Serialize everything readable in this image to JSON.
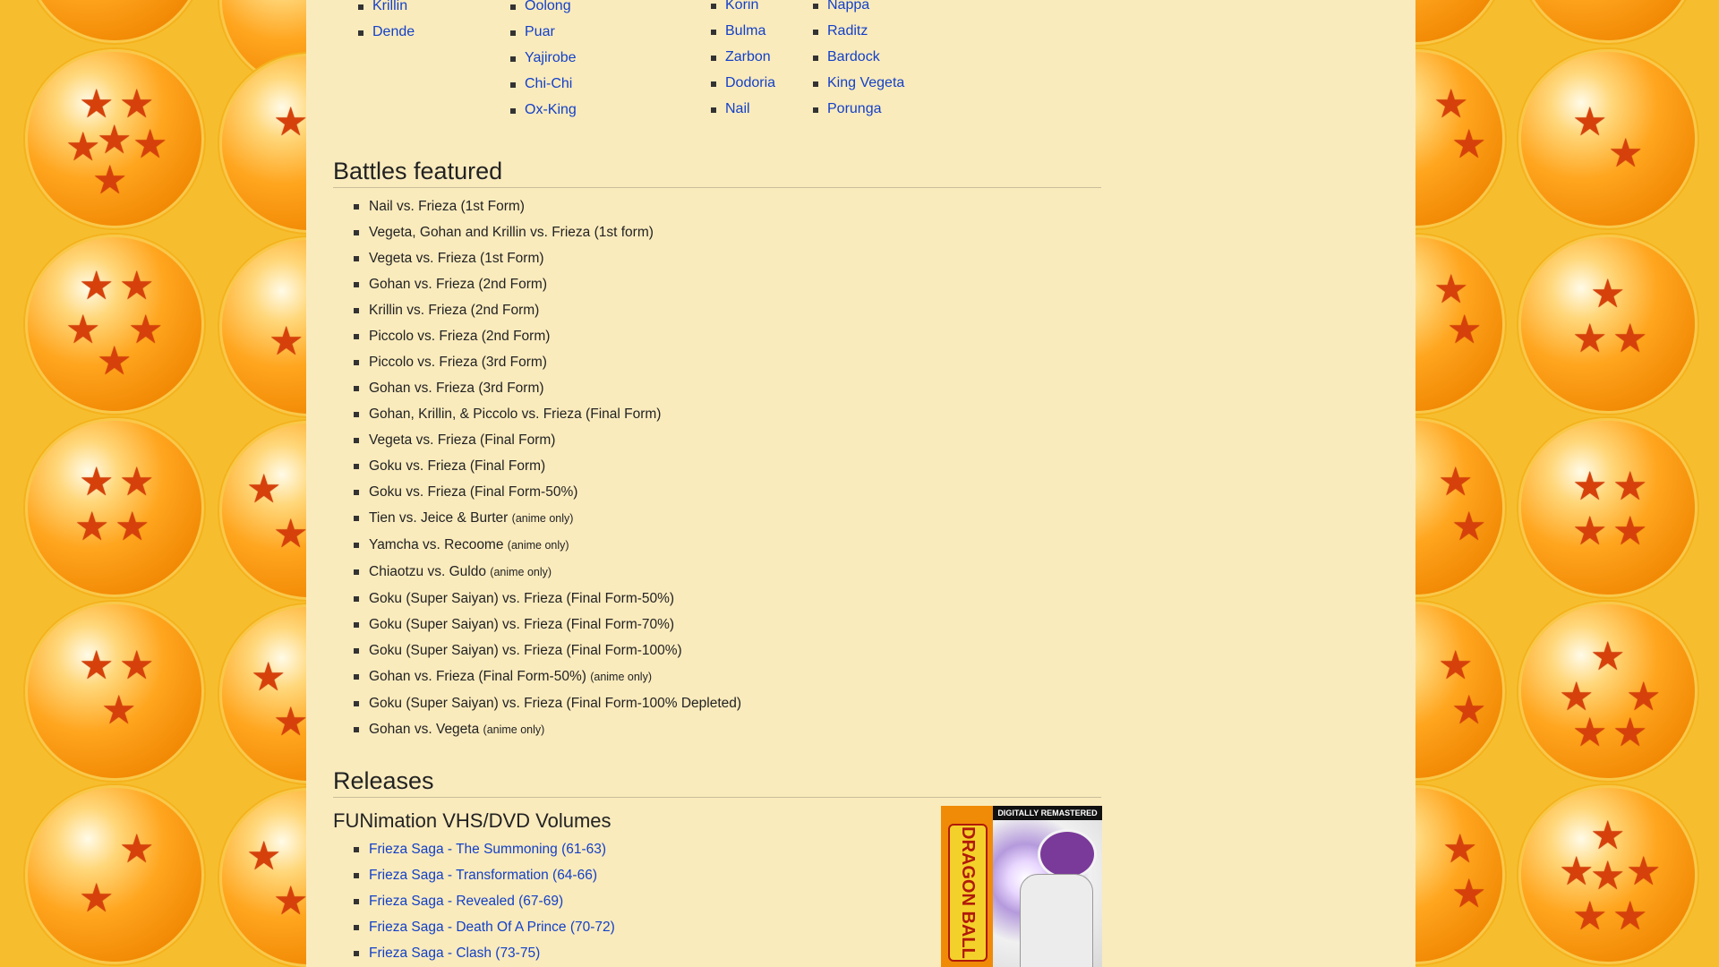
{
  "characters": {
    "col1": [
      "Krillin",
      "Dende"
    ],
    "col2": [
      "Oolong",
      "Puar",
      "Yajirobe",
      "Chi-Chi",
      "Ox-King"
    ],
    "col3": [
      "Korin",
      "Bulma",
      "Zarbon",
      "Dodoria",
      "Nail"
    ],
    "col4": [
      "Nappa",
      "Raditz",
      "Bardock",
      "King Vegeta",
      "Porunga"
    ]
  },
  "battles": {
    "heading": "Battles featured",
    "items": [
      {
        "text": "Nail vs. Frieza (1st Form)",
        "note": ""
      },
      {
        "text": "Vegeta, Gohan and Krillin vs. Frieza (1st form)",
        "note": ""
      },
      {
        "text": "Vegeta vs. Frieza (1st Form)",
        "note": ""
      },
      {
        "text": "Gohan vs. Frieza (2nd Form)",
        "note": ""
      },
      {
        "text": "Krillin vs. Frieza (2nd Form)",
        "note": ""
      },
      {
        "text": "Piccolo vs. Frieza (2nd Form)",
        "note": ""
      },
      {
        "text": "Piccolo vs. Frieza (3rd Form)",
        "note": ""
      },
      {
        "text": "Gohan vs. Frieza (3rd Form)",
        "note": ""
      },
      {
        "text": "Gohan, Krillin, & Piccolo vs. Frieza (Final Form)",
        "note": ""
      },
      {
        "text": "Vegeta vs. Frieza (Final Form)",
        "note": ""
      },
      {
        "text": "Goku vs. Frieza (Final Form)",
        "note": ""
      },
      {
        "text": "Goku vs. Frieza (Final Form-50%)",
        "note": ""
      },
      {
        "text": "Tien vs. Jeice & Burter",
        "note": "(anime only)"
      },
      {
        "text": "Yamcha vs. Recoome",
        "note": "(anime only)"
      },
      {
        "text": "Chiaotzu vs. Guldo",
        "note": "(anime only)"
      },
      {
        "text": "Goku (Super Saiyan) vs. Frieza (Final Form-50%)",
        "note": ""
      },
      {
        "text": "Goku (Super Saiyan) vs. Frieza (Final Form-70%)",
        "note": ""
      },
      {
        "text": "Goku (Super Saiyan) vs. Frieza (Final Form-100%)",
        "note": ""
      },
      {
        "text": "Gohan vs. Frieza (Final Form-50%)",
        "note": "(anime only)"
      },
      {
        "text": "Goku (Super Saiyan) vs. Frieza (Final Form-100% Depleted)",
        "note": ""
      },
      {
        "text": "Gohan vs. Vegeta",
        "note": "(anime only)"
      }
    ]
  },
  "releases": {
    "heading": "Releases",
    "subheading": "FUNimation VHS/DVD Volumes",
    "items": [
      "Frieza Saga - The Summoning (61-63)",
      "Frieza Saga - Transformation (64-66)",
      "Frieza Saga - Revealed (67-69)",
      "Frieza Saga - Death Of A Prince (70-72)",
      "Frieza Saga - Clash (73-75)"
    ],
    "cover_banner": "DIGITALLY REMASTERED",
    "cover_logo": "DRAGON BALL Z"
  },
  "colors": {
    "page_bg": "#f6be2f",
    "content_bg": "#faebbd",
    "link": "#1340c8",
    "text": "#222222",
    "star": "#d6410b"
  }
}
